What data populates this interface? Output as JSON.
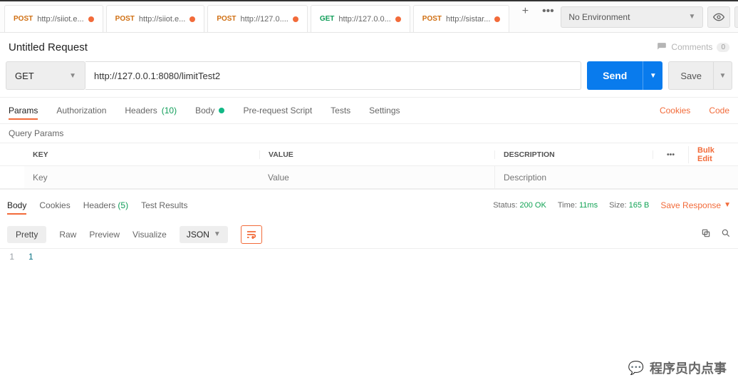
{
  "environment": {
    "label": "No Environment"
  },
  "tabs": [
    {
      "method": "POST",
      "url": "http://siiot.e...",
      "dirty": true,
      "active": false
    },
    {
      "method": "POST",
      "url": "http://siiot.e...",
      "dirty": true,
      "active": false
    },
    {
      "method": "POST",
      "url": "http://127.0....",
      "dirty": true,
      "active": false
    },
    {
      "method": "GET",
      "url": "http://127.0.0...",
      "dirty": true,
      "active": true
    },
    {
      "method": "POST",
      "url": "http://sistar...",
      "dirty": true,
      "active": false
    }
  ],
  "request": {
    "name": "Untitled Request",
    "method": "GET",
    "url": "http://127.0.0.1:8080/limitTest2",
    "send_label": "Send",
    "save_label": "Save"
  },
  "comments": {
    "label": "Comments",
    "count": "0"
  },
  "req_tabs": {
    "params": "Params",
    "auth": "Authorization",
    "headers": "Headers",
    "headers_count": "(10)",
    "body": "Body",
    "prerequest": "Pre-request Script",
    "tests": "Tests",
    "settings": "Settings",
    "cookies_link": "Cookies",
    "code_link": "Code"
  },
  "params_section": {
    "title": "Query Params",
    "cols": {
      "key": "KEY",
      "value": "VALUE",
      "desc": "DESCRIPTION"
    },
    "placeholders": {
      "key": "Key",
      "value": "Value",
      "desc": "Description"
    },
    "bulk_edit": "Bulk Edit"
  },
  "resp_tabs": {
    "body": "Body",
    "cookies": "Cookies",
    "headers": "Headers",
    "headers_count": "(5)",
    "test_results": "Test Results"
  },
  "resp_meta": {
    "status_label": "Status:",
    "status_value": "200 OK",
    "time_label": "Time:",
    "time_value": "11ms",
    "size_label": "Size:",
    "size_value": "165 B",
    "save_response": "Save Response"
  },
  "view": {
    "pretty": "Pretty",
    "raw": "Raw",
    "preview": "Preview",
    "visualize": "Visualize",
    "json": "JSON"
  },
  "response_body": {
    "line": "1",
    "content": "1"
  },
  "watermark": "程序员内点事"
}
